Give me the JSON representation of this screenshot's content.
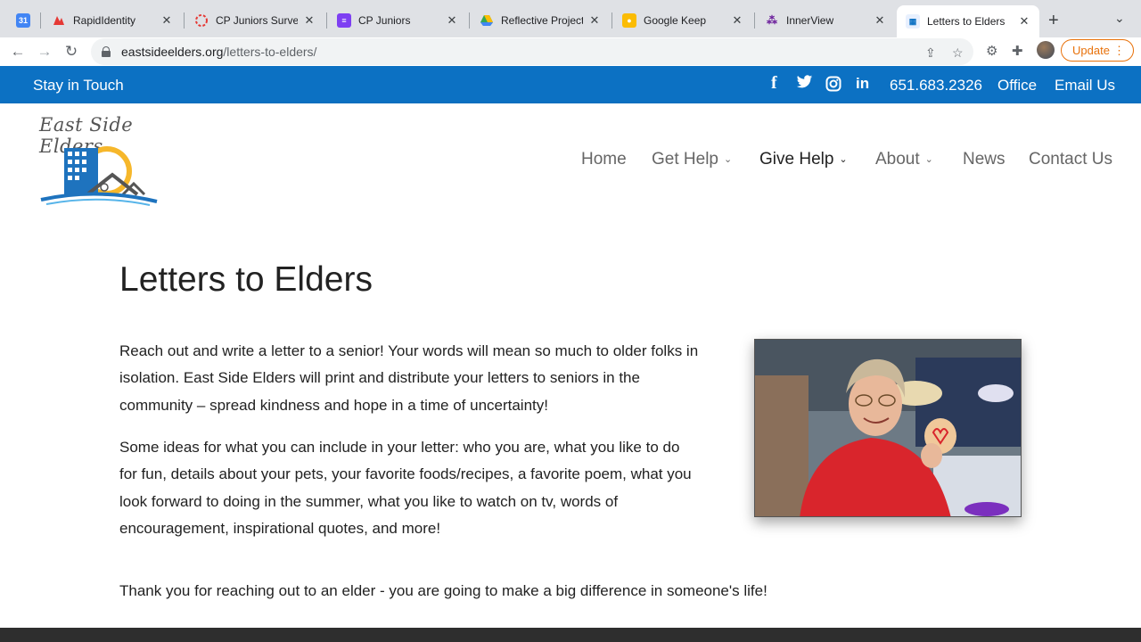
{
  "browser": {
    "tabs": [
      {
        "label": "",
        "icon": "calendar-icon",
        "color": "#4285f4"
      },
      {
        "label": "RapidIdentity",
        "icon": "rapididentity-icon",
        "color": "#e53935"
      },
      {
        "label": "CP Juniors Survey",
        "icon": "survey-icon",
        "color": "#e53935"
      },
      {
        "label": "CP Juniors",
        "icon": "forms-icon",
        "color": "#7e3ff2"
      },
      {
        "label": "Reflective Project",
        "icon": "drive-icon",
        "color": "#34a853"
      },
      {
        "label": "Google Keep",
        "icon": "keep-icon",
        "color": "#fbbc04"
      },
      {
        "label": "InnerView",
        "icon": "innerview-icon",
        "color": "#6a1b9a"
      },
      {
        "label": "Letters to Elders",
        "icon": "site-icon",
        "color": "#0c71c3"
      }
    ],
    "url_host": "eastsideelders.org",
    "url_path": "/letters-to-elders/",
    "update_label": "Update"
  },
  "topbar": {
    "stay_label": "Stay in Touch",
    "social": [
      "facebook-icon",
      "twitter-icon",
      "instagram-icon",
      "linkedin-icon"
    ],
    "phone": "651.683.2326",
    "office": "Office",
    "email": "Email Us",
    "color": "#0c71c3"
  },
  "header": {
    "logo_text": "East Side Elders",
    "nav": [
      {
        "label": "Home"
      },
      {
        "label": "Get Help"
      },
      {
        "label": "Give Help"
      },
      {
        "label": "About"
      },
      {
        "label": "News"
      },
      {
        "label": "Contact Us"
      }
    ]
  },
  "main": {
    "title": "Letters to Elders",
    "para1": "Reach out and write a letter to a senior!  Your words will mean so much to older folks in isolation.  East Side Elders will print and distribute your letters to seniors in the community – spread kindness and hope in a time of uncertainty!",
    "para2": "Some ideas for what you can include in your letter:  who you are, what you like to do for fun, details about your pets, your favorite foods/recipes, a favorite poem, what you look forward to doing in the summer, what you like to watch on tv, words of encouragement, inspirational quotes, and more!",
    "thanks": "Thank you for reaching out to an elder - you are going to make a big difference in someone's life!"
  }
}
